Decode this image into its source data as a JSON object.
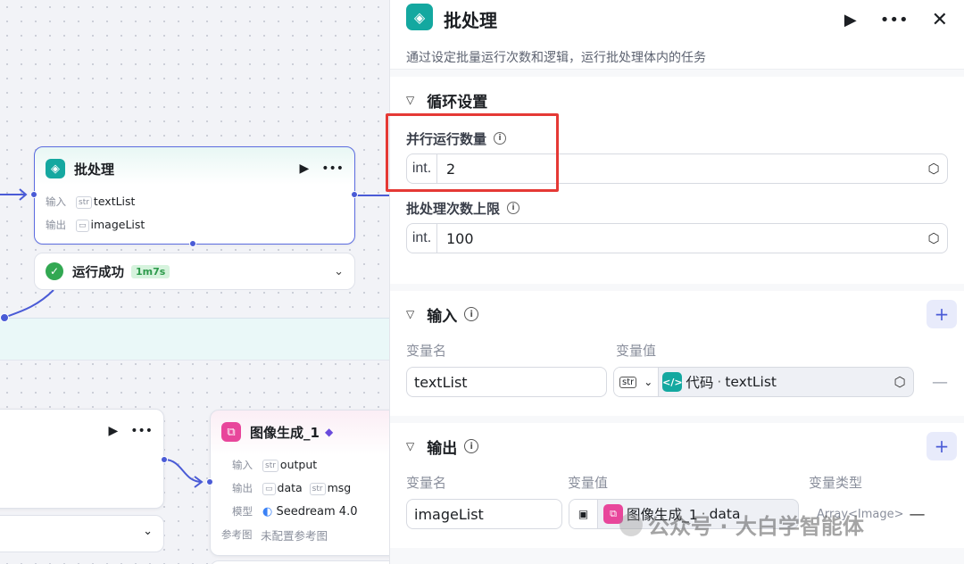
{
  "canvas": {
    "batch_node": {
      "title": "批处理",
      "run_icon": "play-icon",
      "more_icon": "more-icon",
      "input_label": "输入",
      "input_value": "textList",
      "output_label": "输出",
      "output_value": "imageList",
      "status_text": "运行成功",
      "duration": "1m7s"
    },
    "image_node": {
      "title": "图像生成_1",
      "input_label": "输入",
      "input_value": "output",
      "output_label": "输出",
      "output_values": [
        "data",
        "msg"
      ],
      "model_label": "模型",
      "model_value": "Seedream 4.0",
      "ref_label": "参考图",
      "ref_value": "未配置参考图"
    },
    "type_tags": {
      "str": "str",
      "img": "▭"
    }
  },
  "panel": {
    "title": "批处理",
    "description": "通过设定批量运行次数和逻辑，运行批处理体内的任务",
    "loop_section": {
      "title": "循环设置",
      "parallel_label": "并行运行数量",
      "parallel_prefix": "int.",
      "parallel_value": "2",
      "limit_label": "批处理次数上限",
      "limit_prefix": "int.",
      "limit_value": "100"
    },
    "input_section": {
      "title": "输入",
      "col_name": "变量名",
      "col_value": "变量值",
      "var_name": "textList",
      "type_tag": "str",
      "ref_source": "代码",
      "ref_sep": "·",
      "ref_var": "textList"
    },
    "output_section": {
      "title": "输出",
      "col_name": "变量名",
      "col_value": "变量值",
      "col_type": "变量类型",
      "var_name": "imageList",
      "ref_source": "图像生成_1",
      "ref_sep": "·",
      "ref_var": "data",
      "var_type": "Array<Image>"
    }
  },
  "watermark": "公众号 · 大白学智能体",
  "colors": {
    "accent": "#4a5bd6",
    "teal": "#14a8a0",
    "pink": "#e8469b",
    "highlight": "#e53935",
    "success": "#32a852"
  }
}
